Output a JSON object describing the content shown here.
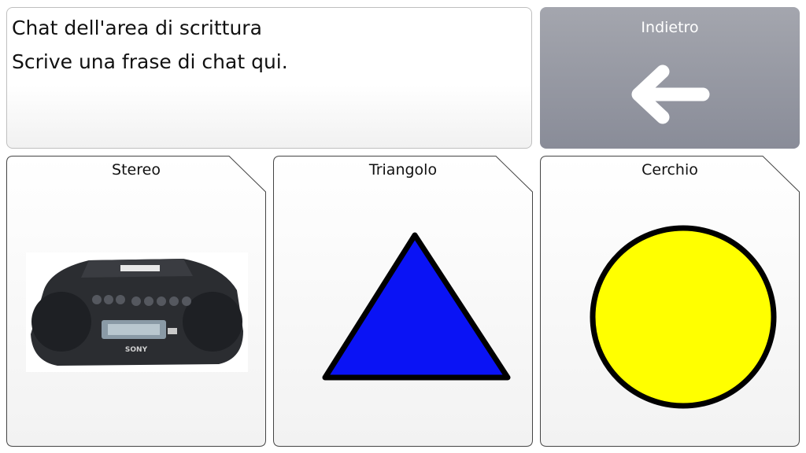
{
  "chat": {
    "title": "Chat dell'area di scrittura",
    "placeholder": "Scrive una frase di chat qui."
  },
  "back_button": {
    "label": "Indietro",
    "icon": "arrow-left-icon"
  },
  "cards": [
    {
      "label": "Stereo",
      "icon": "boombox-image"
    },
    {
      "label": "Triangolo",
      "icon": "triangle-image",
      "color": "#0a13f5"
    },
    {
      "label": "Cerchio",
      "icon": "circle-image",
      "color": "#ffff00"
    }
  ],
  "device_brand": "SONY"
}
